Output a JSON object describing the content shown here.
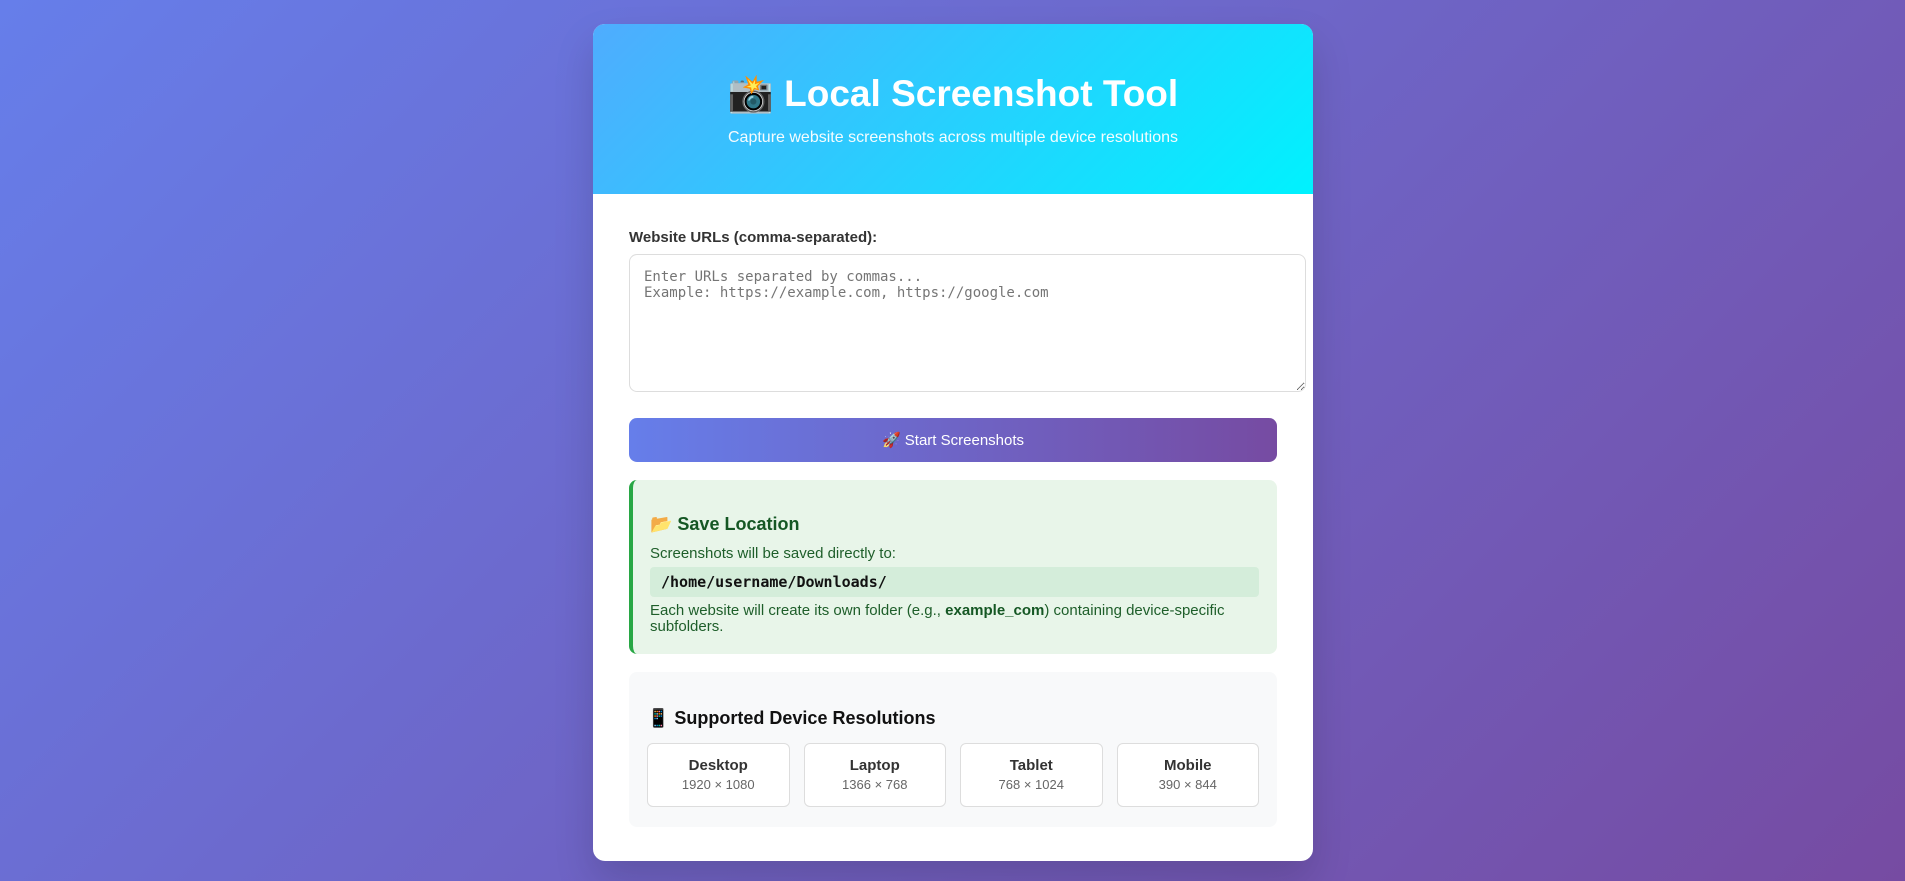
{
  "header": {
    "title": "📸 Local Screenshot Tool",
    "subtitle": "Capture website screenshots across multiple device resolutions"
  },
  "form": {
    "urls_label": "Website URLs (comma-separated):",
    "urls_placeholder": "Enter URLs separated by commas...\nExample: https://example.com, https://google.com",
    "urls_value": "",
    "start_button": "🚀 Start Screenshots"
  },
  "save_location": {
    "title": "📂 Save Location",
    "intro": "Screenshots will be saved directly to:",
    "path": "/home/username/Downloads/",
    "note_before": "Each website will create its own folder (e.g., ",
    "note_example": "example_com",
    "note_after": ") containing device-specific subfolders."
  },
  "devices": {
    "title": "📱 Supported Device Resolutions",
    "items": [
      {
        "name": "Desktop",
        "resolution": "1920 × 1080"
      },
      {
        "name": "Laptop",
        "resolution": "1366 × 768"
      },
      {
        "name": "Tablet",
        "resolution": "768 × 1024"
      },
      {
        "name": "Mobile",
        "resolution": "390 × 844"
      }
    ]
  },
  "colors": {
    "page_gradient": [
      "#667eea",
      "#764ba2"
    ],
    "header_gradient": [
      "#4facfe",
      "#00f2fe"
    ],
    "save_accent": "#28a745"
  }
}
